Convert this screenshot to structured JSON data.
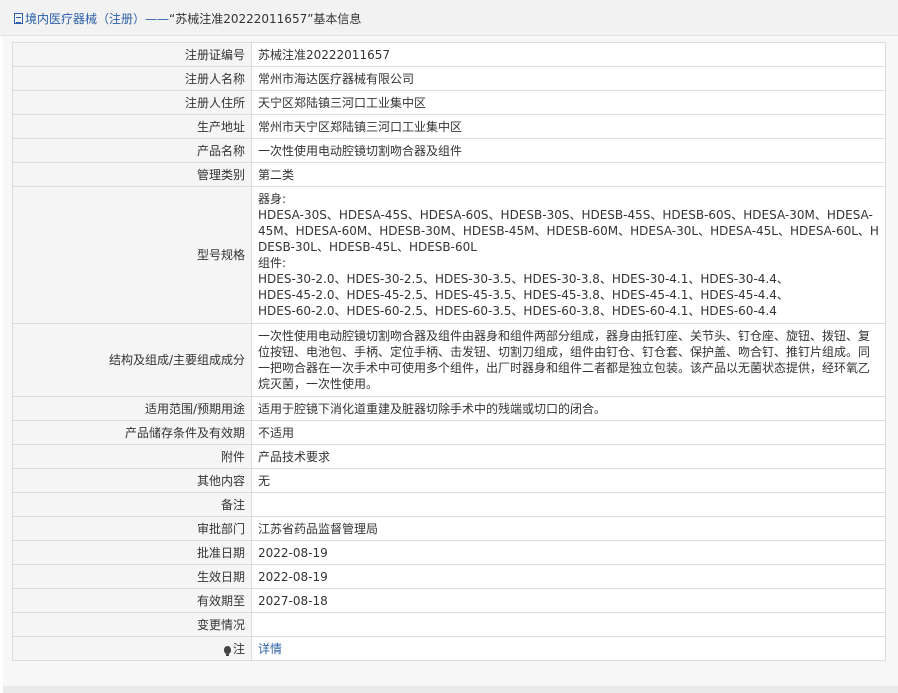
{
  "breadcrumb": {
    "category": "境内医疗器械（注册）",
    "separator": "——",
    "title": "“苏械注准20222011657”基本信息"
  },
  "rows": [
    {
      "label": "注册证编号",
      "value": [
        "苏械注准20222011657"
      ]
    },
    {
      "label": "注册人名称",
      "value": [
        "常州市海达医疗器械有限公司"
      ]
    },
    {
      "label": "注册人住所",
      "value": [
        "天宁区郑陆镇三河口工业集中区"
      ]
    },
    {
      "label": "生产地址",
      "value": [
        "常州市天宁区郑陆镇三河口工业集中区"
      ]
    },
    {
      "label": "产品名称",
      "value": [
        "一次性使用电动腔镜切割吻合器及组件"
      ]
    },
    {
      "label": "管理类别",
      "value": [
        "第二类"
      ]
    },
    {
      "label": "型号规格",
      "value": [
        "器身:",
        "HDESA-30S、HDESA-45S、HDESA-60S、HDESB-30S、HDESB-45S、HDESB-60S、HDESA-30M、HDESA-45M、HDESA-60M、HDESB-30M、HDESB-45M、HDESB-60M、HDESA-30L、HDESA-45L、HDESA-60L、HDESB-30L、HDESB-45L、HDESB-60L",
        "组件:",
        "HDES-30-2.0、HDES-30-2.5、HDES-30-3.5、HDES-30-3.8、HDES-30-4.1、HDES-30-4.4、",
        "HDES-45-2.0、HDES-45-2.5、HDES-45-3.5、HDES-45-3.8、HDES-45-4.1、HDES-45-4.4、",
        "HDES-60-2.0、HDES-60-2.5、HDES-60-3.5、HDES-60-3.8、HDES-60-4.1、HDES-60-4.4"
      ]
    },
    {
      "label": "结构及组成/主要组成成分",
      "value": [
        "一次性使用电动腔镜切割吻合器及组件由器身和组件两部分组成，器身由抵钉座、关节头、钉仓座、旋钮、拨钮、复位按钮、电池包、手柄、定位手柄、击发钮、切割刀组成，组件由钉仓、钉仓套、保护盖、吻合钉、推钉片组成。同一把吻合器在一次手术中可使用多个组件，出厂时器身和组件二者都是独立包装。该产品以无菌状态提供，经环氧乙烷灭菌，一次性使用。"
      ]
    },
    {
      "label": "适用范围/预期用途",
      "value": [
        "适用于腔镜下消化道重建及脏器切除手术中的残端或切口的闭合。"
      ]
    },
    {
      "label": "产品储存条件及有效期",
      "value": [
        "不适用"
      ]
    },
    {
      "label": "附件",
      "value": [
        "产品技术要求"
      ]
    },
    {
      "label": "其他内容",
      "value": [
        "无"
      ]
    },
    {
      "label": "备注",
      "value": [
        ""
      ]
    },
    {
      "label": "审批部门",
      "value": [
        "江苏省药品监督管理局"
      ]
    },
    {
      "label": "批准日期",
      "value": [
        "2022-08-19"
      ]
    },
    {
      "label": "生效日期",
      "value": [
        "2022-08-19"
      ]
    },
    {
      "label": "有效期至",
      "value": [
        "2027-08-18"
      ]
    },
    {
      "label": "变更情况",
      "value": [
        ""
      ]
    }
  ],
  "note": {
    "label": "注",
    "link": "详情",
    "icon": "pin-icon"
  },
  "colors": {
    "link": "#2b5fa8",
    "label_bg": "#f5f5f5",
    "border": "#dcdcdc"
  }
}
